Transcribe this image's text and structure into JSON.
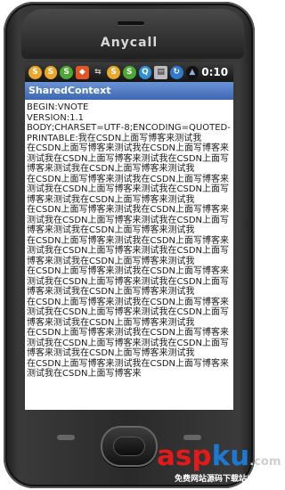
{
  "device": {
    "brand": "Anycall"
  },
  "statusbar": {
    "icons": [
      "sina-icon",
      "sina-icon",
      "sina-icon",
      "weibo-icon",
      "usb-icon",
      "sina-icon",
      "qq-icon",
      "sd-card-icon",
      "sync-icon",
      "signal-icon"
    ],
    "time": "0:10"
  },
  "app": {
    "title": "SharedContext"
  },
  "content": {
    "text": "BEGIN:VNOTE\nVERSION:1.1\nBODY;CHARSET=UTF-8;ENCODING=QUOTED-PRINTABLE:我在CSDN上面写博客来测试我\n在CSDN上面写博客来测试我在CSDN上面写博客来测试我在CSDN上面写博客来测试我在CSDN上面写博客来测试我在CSDN上面写博客来测试我\n在CSDN上面写博客来测试我在CSDN上面写博客来测试我在CSDN上面写博客来测试我在CSDN上面写博客来测试我在CSDN上面写博客来测试我\n在CSDN上面写博客来测试我在CSDN上面写博客来测试我在CSDN上面写博客来测试我在CSDN上面写博客来测试我在CSDN上面写博客来测试我\n在CSDN上面写博客来测试我在CSDN上面写博客来测试我在CSDN上面写博客来测试我在CSDN上面写博客来测试我在CSDN上面写博客来测试我\n在CSDN上面写博客来测试我在CSDN上面写博客来测试我在CSDN上面写博客来测试我在CSDN上面写博客来测试我在CSDN上面写博客来测试我\n在CSDN上面写博客来测试我在CSDN上面写博客来测试我在CSDN上面写博客来测试我在CSDN上面写博客来测试我在CSDN上面写博客来测试我\n在CSDN上面写博客来测试我在CSDN上面写博客来测试我在CSDN上面写博客来测试我在CSDN上面写博客来测试我在CSDN上面写博客来测试我\n在CSDN上面写博客来测试我在CSDN上面写博客来测试我在CSDN上面写博客来"
  },
  "watermark": {
    "a": "asp",
    "b": "ku",
    "c": ".com",
    "sub": "免费网站源码下载站!"
  }
}
